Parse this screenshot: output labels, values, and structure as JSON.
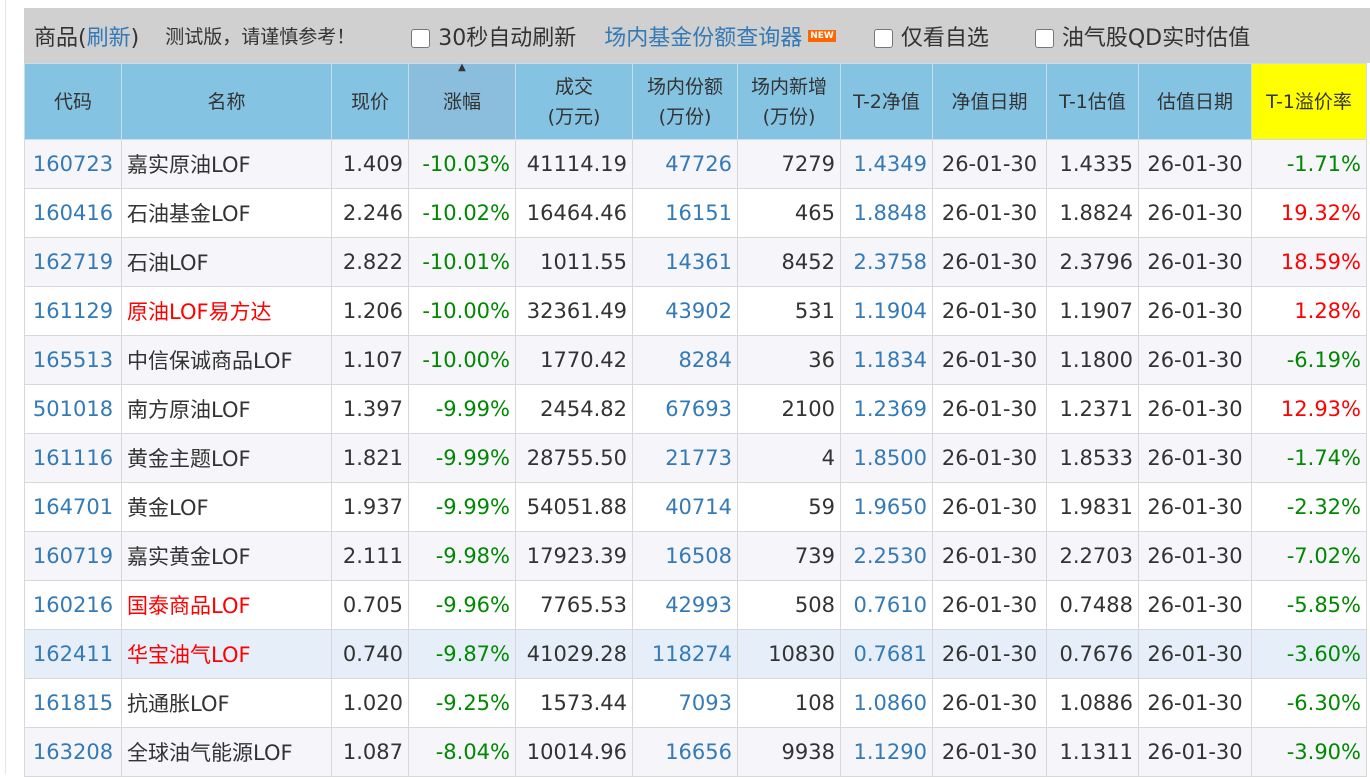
{
  "toolbar": {
    "title_prefix": "商品(",
    "refresh": "刷新",
    "title_suffix": ")",
    "notice": "测试版，请谨慎参考！",
    "auto_refresh": "30秒自动刷新",
    "query_link": "场内基金份额查询器",
    "new_badge": "NEW",
    "only_watch": "仅看自选",
    "oil_qd": "油气股QD实时估值"
  },
  "headers": [
    "代码",
    "名称",
    "现价",
    "涨幅",
    "成交\n(万元)",
    "场内份额\n(万份)",
    "场内新增\n(万份)",
    "T-2净值",
    "净值日期",
    "T-1估值",
    "估值日期",
    "T-1溢价率"
  ],
  "colors": {
    "header": "#85c3e3",
    "premium_header": "#ffff00",
    "link": "#337ab7",
    "up": "#ff0000",
    "down": "#008800"
  },
  "rows": [
    [
      "160723",
      "嘉实原油LOF",
      "1.409",
      "-10.03%",
      "41114.19",
      "47726",
      "7279",
      "1.4349",
      "26-01-30",
      "1.4335",
      "26-01-30",
      "-1.71%"
    ],
    [
      "160416",
      "石油基金LOF",
      "2.246",
      "-10.02%",
      "16464.46",
      "16151",
      "465",
      "1.8848",
      "26-01-30",
      "1.8824",
      "26-01-30",
      "19.32%"
    ],
    [
      "162719",
      "石油LOF",
      "2.822",
      "-10.01%",
      "1011.55",
      "14361",
      "8452",
      "2.3758",
      "26-01-30",
      "2.3796",
      "26-01-30",
      "18.59%"
    ],
    [
      "161129",
      "原油LOF易方达",
      "1.206",
      "-10.00%",
      "32361.49",
      "43902",
      "531",
      "1.1904",
      "26-01-30",
      "1.1907",
      "26-01-30",
      "1.28%"
    ],
    [
      "165513",
      "中信保诚商品LOF",
      "1.107",
      "-10.00%",
      "1770.42",
      "8284",
      "36",
      "1.1834",
      "26-01-30",
      "1.1800",
      "26-01-30",
      "-6.19%"
    ],
    [
      "501018",
      "南方原油LOF",
      "1.397",
      "-9.99%",
      "2454.82",
      "67693",
      "2100",
      "1.2369",
      "26-01-30",
      "1.2371",
      "26-01-30",
      "12.93%"
    ],
    [
      "161116",
      "黄金主题LOF",
      "1.821",
      "-9.99%",
      "28755.50",
      "21773",
      "4",
      "1.8500",
      "26-01-30",
      "1.8533",
      "26-01-30",
      "-1.74%"
    ],
    [
      "164701",
      "黄金LOF",
      "1.937",
      "-9.99%",
      "54051.88",
      "40714",
      "59",
      "1.9650",
      "26-01-30",
      "1.9831",
      "26-01-30",
      "-2.32%"
    ],
    [
      "160719",
      "嘉实黄金LOF",
      "2.111",
      "-9.98%",
      "17923.39",
      "16508",
      "739",
      "2.2530",
      "26-01-30",
      "2.2703",
      "26-01-30",
      "-7.02%"
    ],
    [
      "160216",
      "国泰商品LOF",
      "0.705",
      "-9.96%",
      "7765.53",
      "42993",
      "508",
      "0.7610",
      "26-01-30",
      "0.7488",
      "26-01-30",
      "-5.85%"
    ],
    [
      "162411",
      "华宝油气LOF",
      "0.740",
      "-9.87%",
      "41029.28",
      "118274",
      "10830",
      "0.7681",
      "26-01-30",
      "0.7676",
      "26-01-30",
      "-3.60%"
    ],
    [
      "161815",
      "抗通胀LOF",
      "1.020",
      "-9.25%",
      "1573.44",
      "7093",
      "108",
      "1.0860",
      "26-01-30",
      "1.0886",
      "26-01-30",
      "-6.30%"
    ],
    [
      "163208",
      "全球油气能源LOF",
      "1.087",
      "-8.04%",
      "10014.96",
      "16656",
      "9938",
      "1.1290",
      "26-01-30",
      "1.1311",
      "26-01-30",
      "-3.90%"
    ]
  ],
  "red_names": [
    "161129",
    "160216",
    "162411"
  ],
  "highlight_row": "162411"
}
